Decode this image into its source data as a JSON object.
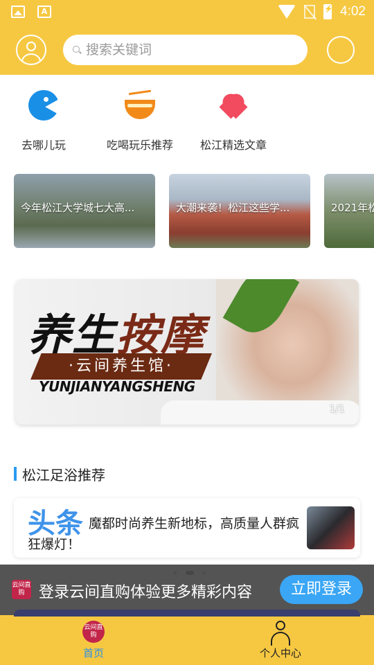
{
  "status_bar": {
    "time": "4:02",
    "notification_icons": [
      "image-icon",
      "text-app-icon"
    ]
  },
  "header": {
    "search_placeholder": "搜索关键词"
  },
  "quick_nav": [
    {
      "label": "去哪儿玩",
      "icon": "blue-chat-icon"
    },
    {
      "label": "吃喝玩乐推荐",
      "icon": "bowl-icon"
    },
    {
      "label": "松江精选文章",
      "icon": "heart-icon"
    }
  ],
  "articles": [
    {
      "title": "今年松江大学城七大高..."
    },
    {
      "title": "大潮来袭！松江这些学..."
    },
    {
      "title": "2021年松"
    }
  ],
  "banner": {
    "title_part1": "养生",
    "title_part2": "按摩",
    "subtitle": "·云间养生馆·",
    "pinyin": "YUNJIANYANGSHENG",
    "pager": "1/1"
  },
  "section": {
    "title": "松江足浴推荐"
  },
  "headline": {
    "tag": "头条",
    "text": "魔都时尚养生新地标，高质量人群疯狂爆灯！"
  },
  "login_prompt": {
    "logo_text": "云间直购",
    "message": "登录云间直购体验更多精彩内容",
    "button": "立即登录"
  },
  "tabbar": [
    {
      "label": "首页",
      "logo_text": "云间直购"
    },
    {
      "label": "个人中心"
    }
  ],
  "colors": {
    "brand_yellow": "#f6c842",
    "accent_blue": "#3aa6f5",
    "brand_red": "#c2254a"
  }
}
